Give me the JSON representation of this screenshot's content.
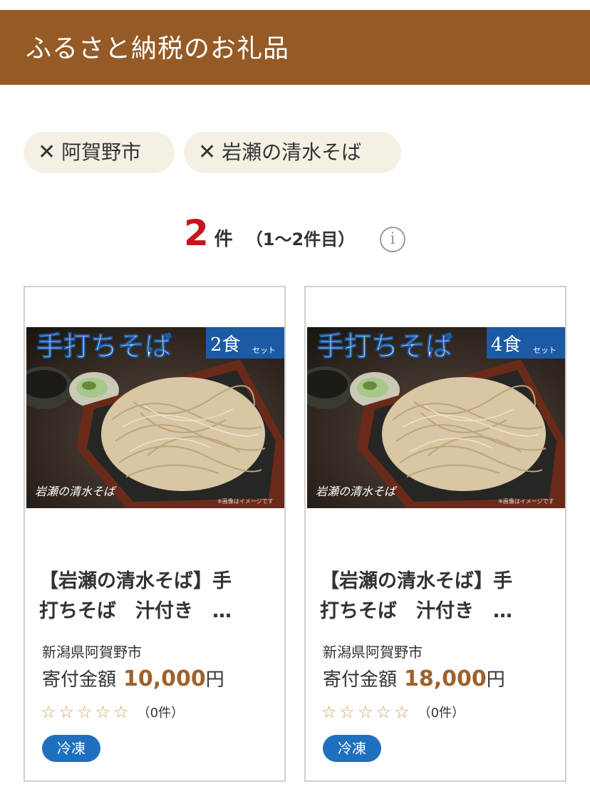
{
  "header": {
    "title": "ふるさと納税のお礼品"
  },
  "filters": [
    {
      "icon": "close-icon",
      "label": "阿賀野市"
    },
    {
      "icon": "close-icon",
      "label": "岩瀬の清水そば"
    }
  ],
  "results": {
    "count": "2",
    "unit": "件",
    "range": "（1〜2件目）",
    "info_icon": "info-icon"
  },
  "products": [
    {
      "banner_title": "手打ちそば",
      "banner_qty": "2食",
      "banner_set": "セット",
      "brand_logo": "岩瀬の清水そば",
      "image_note": "※画像はイメージです",
      "title_line1": "【岩瀬の清水そば】手",
      "title_line2": "打ちそば　汁付き　…",
      "area": "新潟県阿賀野市",
      "price_label": "寄付金額",
      "price_value": "10,000",
      "price_unit": "円",
      "rating": 0,
      "review_count": "（0件）",
      "tag": "冷凍"
    },
    {
      "banner_title": "手打ちそば",
      "banner_qty": "4食",
      "banner_set": "セット",
      "brand_logo": "岩瀬の清水そば",
      "image_note": "※画像はイメージです",
      "title_line1": "【岩瀬の清水そば】手",
      "title_line2": "打ちそば　汁付き　…",
      "area": "新潟県阿賀野市",
      "price_label": "寄付金額",
      "price_value": "18,000",
      "price_unit": "円",
      "rating": 0,
      "review_count": "（0件）",
      "tag": "冷凍"
    }
  ],
  "colors": {
    "header_bg": "#955a25",
    "chip_bg": "#f4f0e3",
    "count_red": "#c4161c",
    "price_brown": "#a0612a",
    "star_gold": "#c9a258",
    "tag_blue": "#1f6fbf"
  }
}
